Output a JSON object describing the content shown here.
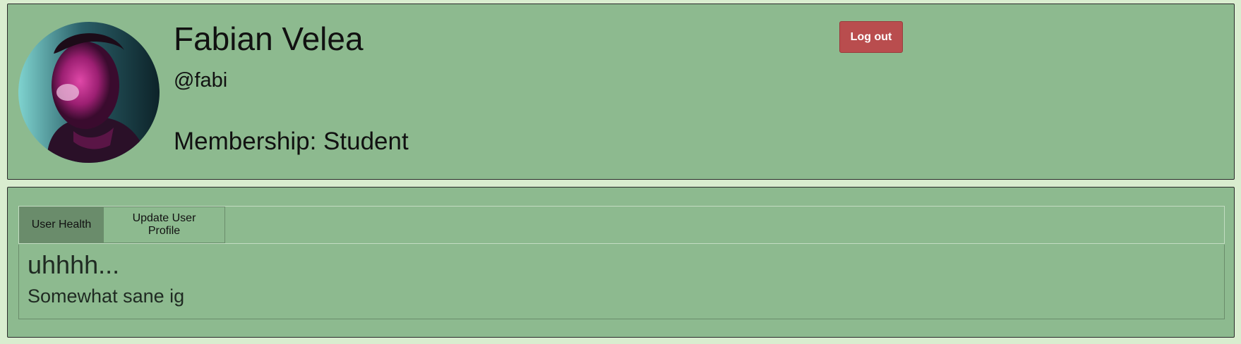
{
  "profile": {
    "name": "Fabian Velea",
    "handle": "@fabi",
    "membership_label": "Membership:",
    "membership_value": "Student",
    "avatar_icon": "user-photo-avatar"
  },
  "actions": {
    "logout_label": "Log out",
    "logout_color": "#b94d4e"
  },
  "tabs": [
    {
      "label": "User Health",
      "active": true
    },
    {
      "label": "Update User Profile",
      "active": false
    }
  ],
  "panel": {
    "heading": "uhhhh...",
    "text": "Somewhat sane ig"
  },
  "colors": {
    "page_background": "#d9edcf",
    "card_background": "#8dba8f",
    "active_tab": "#6a8c6b"
  }
}
